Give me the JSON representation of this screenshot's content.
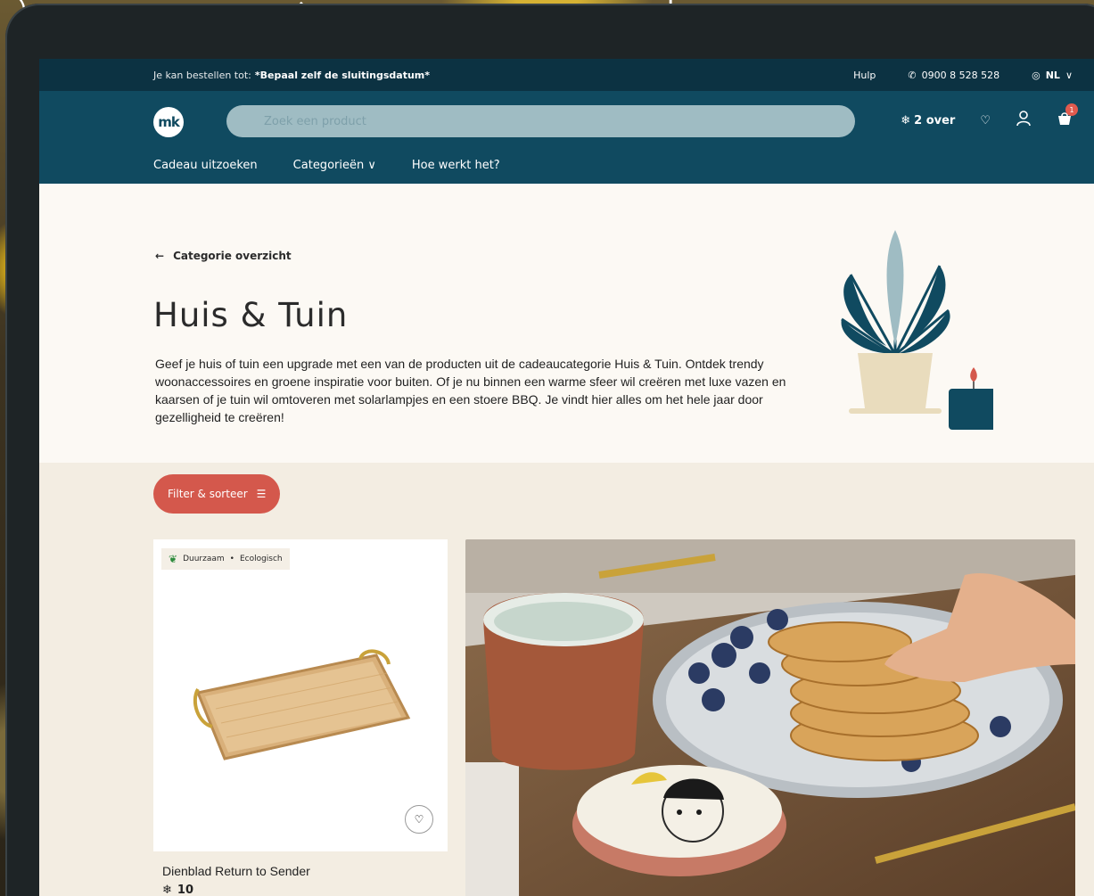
{
  "utility_bar": {
    "order_text": "Je kan bestellen tot:",
    "order_date": "*Bepaal zelf de sluitingsdatum*",
    "help_label": "Hulp",
    "phone": "0900 8 528 528",
    "language": "NL"
  },
  "header": {
    "logo_text": "mk",
    "search_placeholder": "Zoek een product",
    "snow_balance": "2 over",
    "cart_count": "1",
    "nav": [
      "Cadeau uitzoeken",
      "Categorieën",
      "Hoe werkt het?"
    ]
  },
  "hero": {
    "back_label": "Categorie overzicht",
    "title": "Huis & Tuin",
    "intro": "Geef je huis of tuin een upgrade met een van de producten uit de cadeaucategorie Huis & Tuin. Ontdek trendy woonaccessoires en groene inspiratie voor buiten. Of je nu binnen een warme sfeer wil creëren met luxe vazen en kaarsen of je tuin wil omtoveren met solarlampjes en een stoere BBQ. Je vindt hier alles om het hele jaar door gezelligheid te creëren!"
  },
  "listing": {
    "filter_label": "Filter & sorteer",
    "products": [
      {
        "tags": [
          "Duurzaam",
          "Ecologisch"
        ],
        "name": "Dienblad Return to Sender",
        "price": "10"
      }
    ]
  },
  "icons": {
    "phone": "phone-icon",
    "globe": "globe-icon",
    "snowflake": "snowflake-icon",
    "heart": "heart-icon",
    "user": "user-icon",
    "cart": "cart-icon",
    "search": "search-icon",
    "filter": "sliders-icon"
  },
  "colors": {
    "utility_bg": "#0c3242",
    "header_bg": "#104a60",
    "hero_bg": "#fcf9f4",
    "listing_bg": "#f3ede2",
    "accent": "#d4584c"
  }
}
